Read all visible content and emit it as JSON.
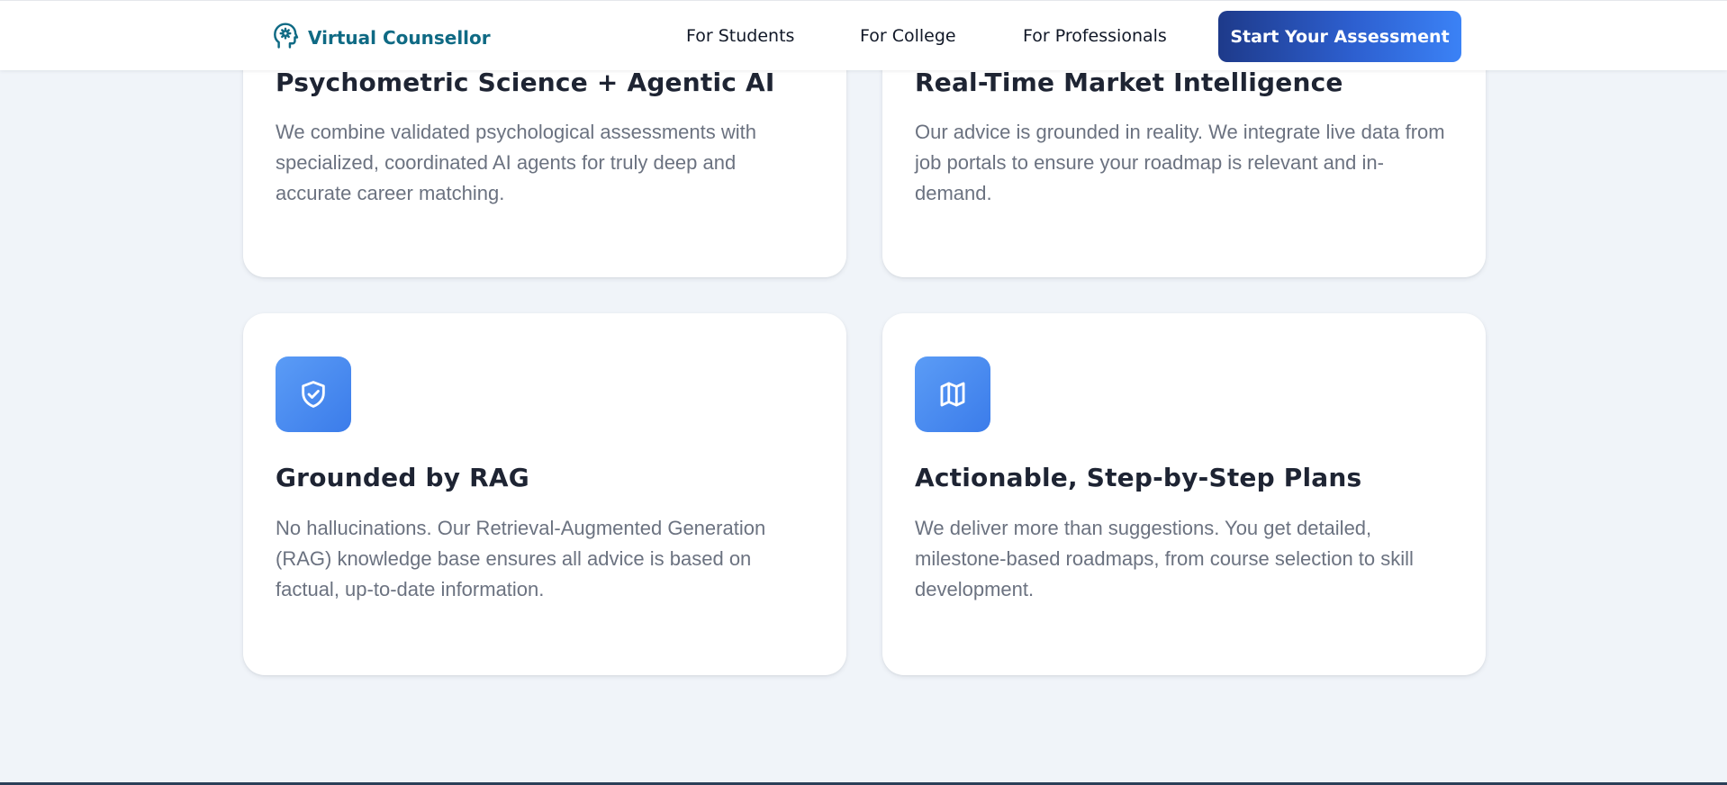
{
  "header": {
    "brand_name": "Virtual Counsellor",
    "brand_icon": "brain-head-icon",
    "nav": [
      {
        "label": "For Students"
      },
      {
        "label": "For College"
      },
      {
        "label": "For Professionals"
      }
    ],
    "cta_label": "Start Your Assessment"
  },
  "features": [
    {
      "title": "Psychometric Science + Agentic AI",
      "description": "We combine validated psychological assessments with specialized, coordinated AI agents for truly deep and accurate career matching."
    },
    {
      "title": "Real-Time Market Intelligence",
      "description": "Our advice is grounded in reality. We integrate live data from job portals to ensure your roadmap is relevant and in-demand."
    },
    {
      "title": "Grounded by RAG",
      "description": "No hallucinations. Our Retrieval-Augmented Generation (RAG) knowledge base ensures all advice is based on factual, up-to-date information.",
      "icon": "shield-check-icon"
    },
    {
      "title": "Actionable, Step-by-Step Plans",
      "description": "We deliver more than suggestions. You get detailed, milestone-based roadmaps, from course selection to skill development.",
      "icon": "map-icon"
    }
  ],
  "colors": {
    "page_background": "#f0f4f9",
    "brand": "#0f6a84",
    "cta_gradient_start": "#1e3a8a",
    "cta_gradient_end": "#3b82f6",
    "icon_tile": "#4f8ef3"
  }
}
